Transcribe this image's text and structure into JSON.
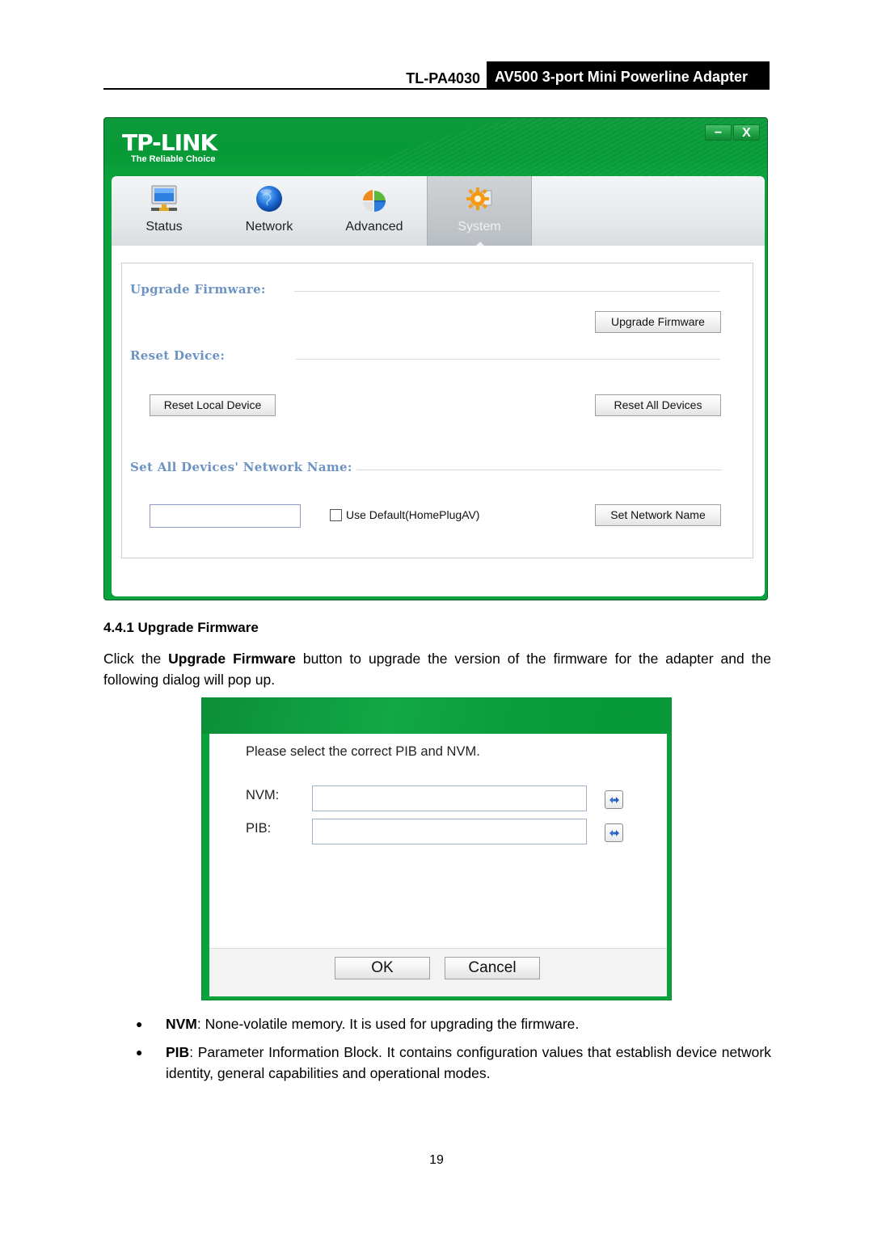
{
  "page_header": {
    "model": "TL-PA4030",
    "product": "AV500 3-port Mini Powerline Adapter"
  },
  "app": {
    "brand": "TP-LINK",
    "tagline": "The Reliable Choice",
    "window_controls": {
      "minimize": "−",
      "close": "X"
    },
    "colors": {
      "brand_green": "#07a33d",
      "section_title": "#6d93c3"
    },
    "tabs": [
      {
        "label": "Status",
        "icon": "monitor-icon",
        "active": false
      },
      {
        "label": "Network",
        "icon": "globe-icon",
        "active": false
      },
      {
        "label": "Advanced",
        "icon": "advanced-chart-icon",
        "active": false
      },
      {
        "label": "System",
        "icon": "gear-icon",
        "active": true
      }
    ],
    "sections": {
      "upgrade_firmware": {
        "title": "Upgrade Firmware:",
        "button": "Upgrade Firmware"
      },
      "reset_device": {
        "title": "Reset Device:",
        "reset_local_button": "Reset Local Device",
        "reset_all_button": "Reset All Devices"
      },
      "network_name": {
        "title": "Set All Devices' Network Name:",
        "input_value": "",
        "checkbox_label": "Use Default(HomePlugAV)",
        "checkbox_checked": false,
        "button": "Set Network Name"
      }
    }
  },
  "document": {
    "section_heading": "4.4.1 Upgrade Firmware",
    "intro": {
      "before": "Click the ",
      "bold": "Upgrade Firmware",
      "after": " button to upgrade the version of the firmware for the adapter and the following dialog will pop up."
    },
    "bullets": [
      {
        "term": "NVM",
        "text": ": None-volatile memory. It is used for upgrading the firmware."
      },
      {
        "term": "PIB",
        "text": ": Parameter Information Block. It contains configuration values that establish device network identity, general capabilities and operational modes."
      }
    ],
    "page_number": "19"
  },
  "dialog": {
    "prompt": "Please select the correct PIB and NVM.",
    "fields": [
      {
        "label": "NVM:",
        "value": "",
        "browse_icon": "browse-file-icon"
      },
      {
        "label": "PIB:",
        "value": "",
        "browse_icon": "browse-file-icon"
      }
    ],
    "ok_label": "OK",
    "cancel_label": "Cancel"
  }
}
